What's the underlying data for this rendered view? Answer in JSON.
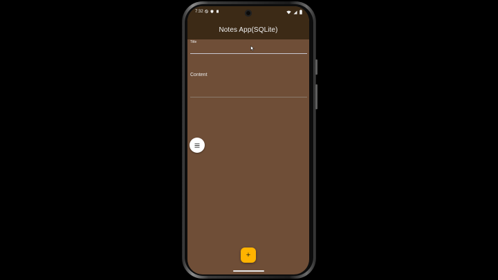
{
  "status_bar": {
    "time": "7:32",
    "left_icons": [
      "do-not-disturb-icon",
      "shield-icon",
      "sd-card-icon"
    ],
    "right_icons": [
      "wifi-icon",
      "signal-icon",
      "battery-icon"
    ]
  },
  "app_bar": {
    "title": "Notes App(SQLite)"
  },
  "form": {
    "title_label": "Title",
    "title_value": "",
    "content_label": "Content",
    "content_value": ""
  },
  "fabs": {
    "menu_icon": "menu-icon",
    "add_label": "+"
  },
  "colors": {
    "app_bar": "#3c2a16",
    "background": "#6f4e37",
    "accent": "#ffb300",
    "menu_fab": "#ffffff"
  }
}
